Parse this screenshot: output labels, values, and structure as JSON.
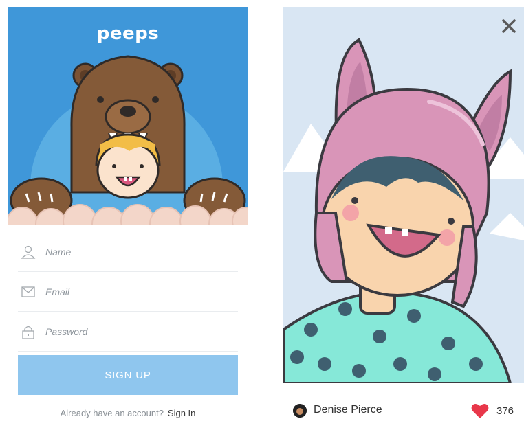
{
  "signup": {
    "brand": "peeps",
    "fields": [
      {
        "icon": "user-icon",
        "placeholder": "Name"
      },
      {
        "icon": "envelope-icon",
        "placeholder": "Email"
      },
      {
        "icon": "lock-icon",
        "placeholder": "Password"
      }
    ],
    "button_label": "SIGN UP",
    "signin_prompt": "Already have an account?",
    "signin_link": "Sign In"
  },
  "profile": {
    "close_icon": "close-icon",
    "user_name": "Denise Pierce",
    "like_icon": "heart-icon",
    "like_count": "376"
  },
  "colors": {
    "hero_blue": "#3f97d9",
    "button_blue": "#8fc6ee",
    "heart_red": "#e8374a",
    "shirt_mint": "#86e8d8",
    "hat_pink": "#d995b8"
  }
}
